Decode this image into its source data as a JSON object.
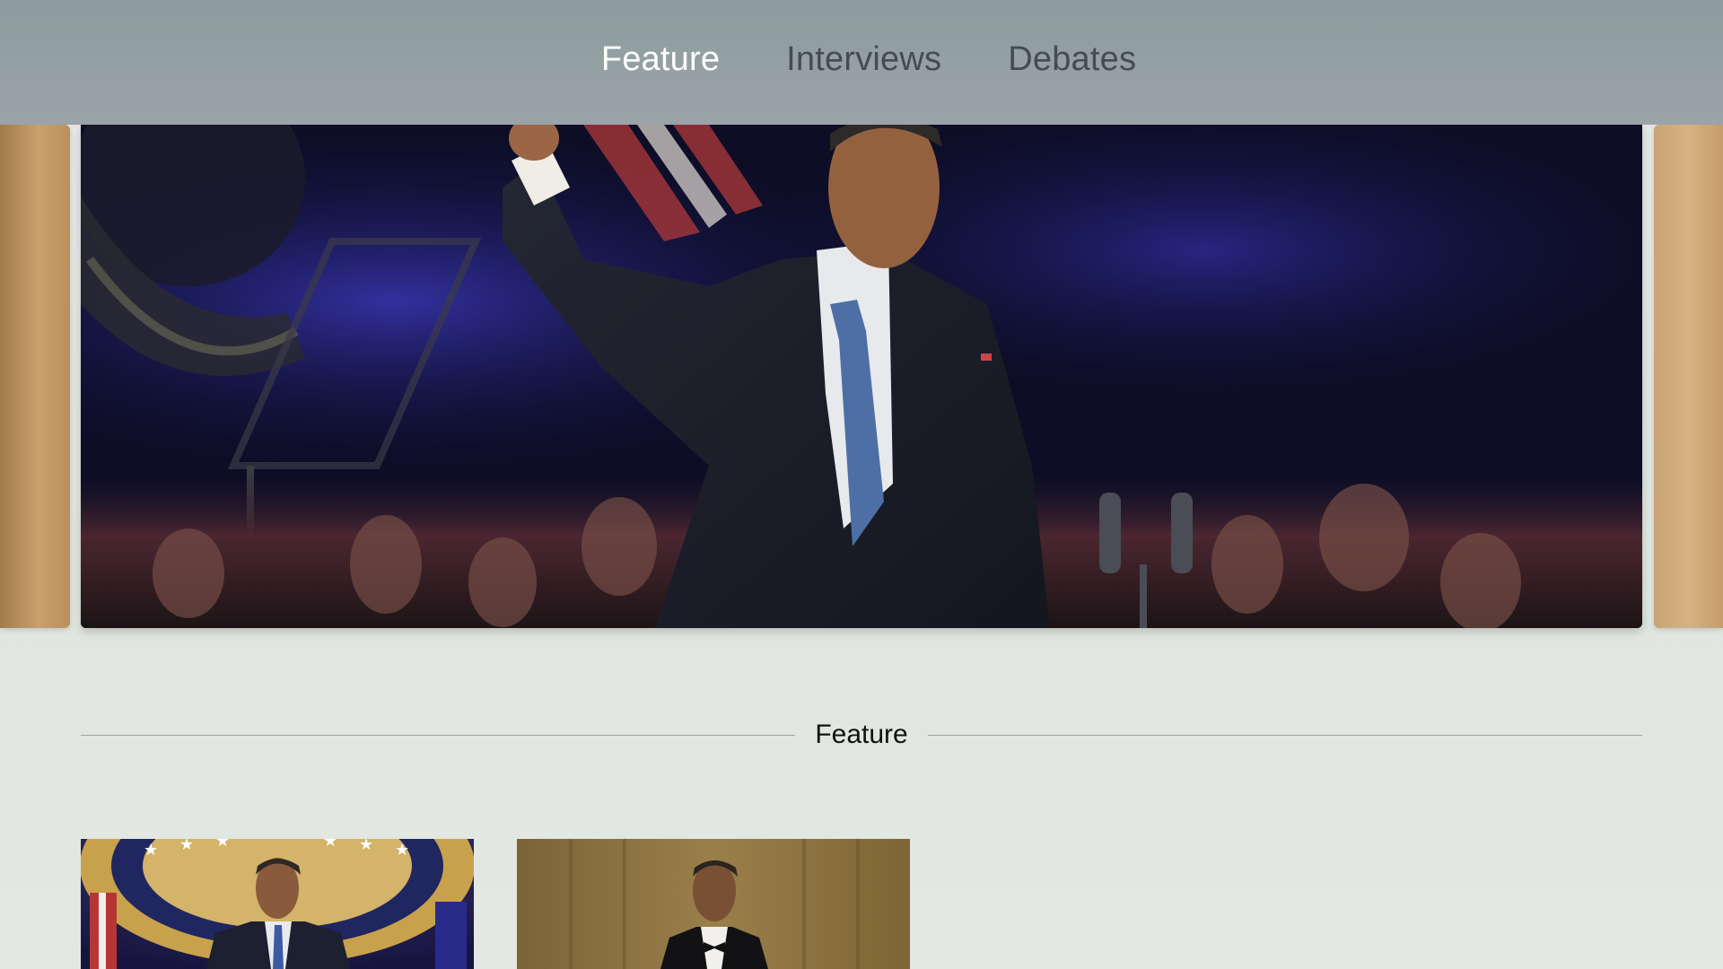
{
  "tabs": [
    {
      "label": "Feature",
      "active": true
    },
    {
      "label": "Interviews",
      "active": false
    },
    {
      "label": "Debates",
      "active": false
    }
  ],
  "section": {
    "title": "Feature"
  },
  "colors": {
    "tabbar": "#939fa3",
    "active_tab": "#ffffff",
    "inactive_tab": "#454c50",
    "background": "#e3e7e3"
  }
}
